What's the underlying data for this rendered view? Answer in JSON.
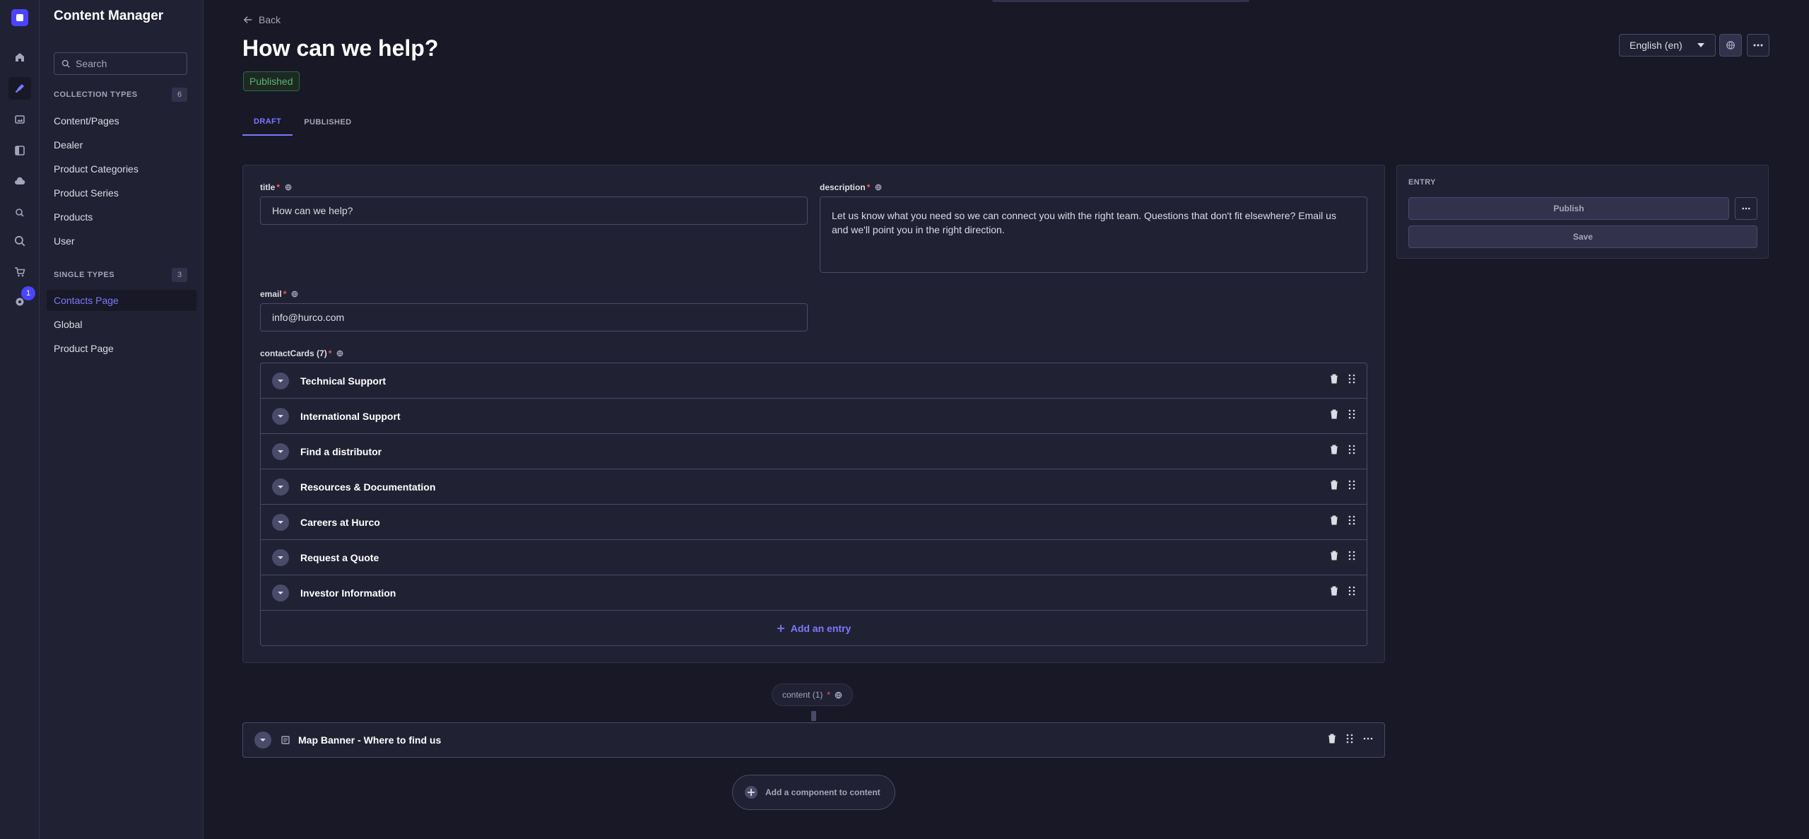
{
  "app": {
    "title": "Content Manager",
    "notification_count": "1"
  },
  "sidebar": {
    "search_placeholder": "Search",
    "collection_header": "COLLECTION TYPES",
    "collection_count": "6",
    "collection_items": [
      "Content/Pages",
      "Dealer",
      "Product Categories",
      "Product Series",
      "Products",
      "User"
    ],
    "single_header": "SINGLE TYPES",
    "single_count": "3",
    "single_items": [
      "Contacts Page",
      "Global",
      "Product Page"
    ]
  },
  "header": {
    "back_label": "Back",
    "title": "How can we help?",
    "status": "Published",
    "locale": "English (en)",
    "tabs": [
      "DRAFT",
      "PUBLISHED"
    ]
  },
  "form": {
    "title_label": "title",
    "title_value": "How can we help?",
    "description_label": "description",
    "description_value": "Let us know what you need so we can connect you with the right team. Questions that don't fit elsewhere? Email us and we'll point you in the right direction.",
    "email_label": "email",
    "email_value": "info@hurco.com",
    "cards_label": "contactCards (7)",
    "cards": [
      "Technical Support",
      "International Support",
      "Find a distributor",
      "Resources & Documentation",
      "Careers at Hurco",
      "Request a Quote",
      "Investor Information"
    ],
    "add_entry": "Add an entry"
  },
  "entry_panel": {
    "header": "ENTRY",
    "publish": "Publish",
    "save": "Save"
  },
  "dynamic_zone": {
    "label": "content (1)",
    "component": "Map Banner - Where to find us",
    "add_component": "Add a component to content"
  },
  "colors": {
    "background": "#181826",
    "panel": "#212134",
    "accent": "#7b79ff",
    "brand": "#4945ff",
    "success": "#5cb176",
    "required": "#ee5e52"
  }
}
